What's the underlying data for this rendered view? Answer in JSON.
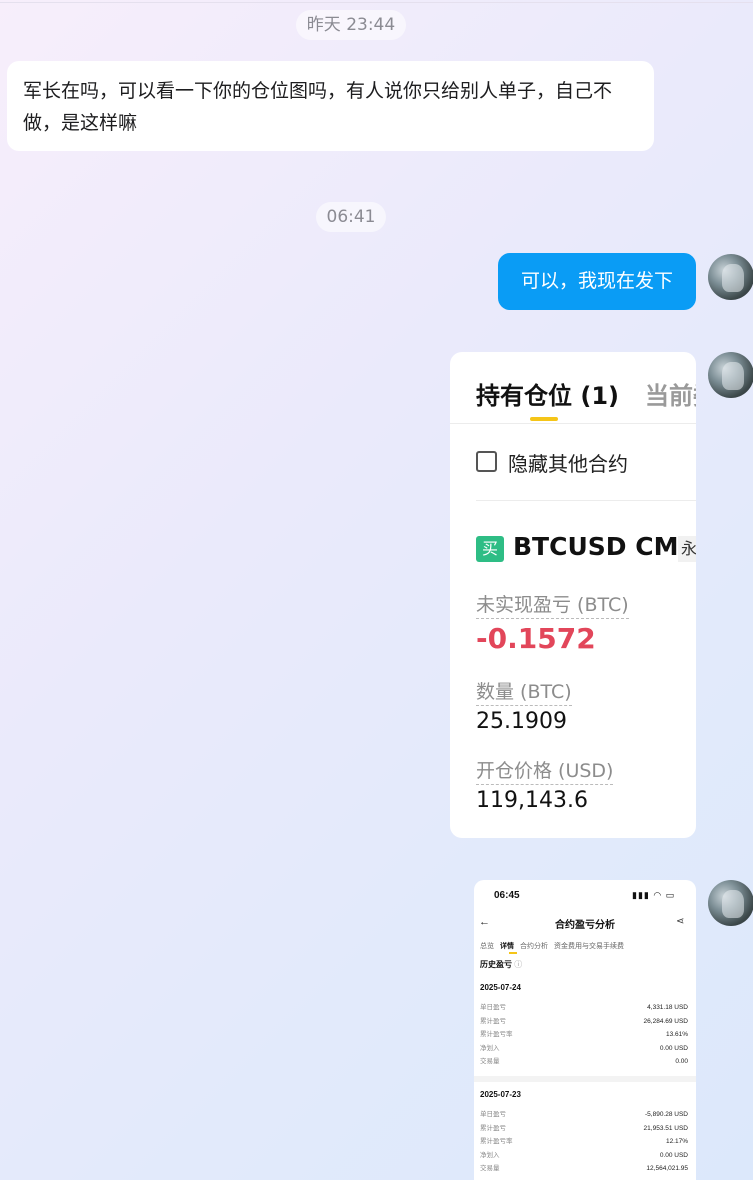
{
  "chat": {
    "timestamp_1": "昨天 23:44",
    "message_1": "军长在吗，可以看一下你的仓位图吗，有人说你只给别人单子，自己不做，是这样嘛",
    "timestamp_2": "06:41",
    "message_2": "可以，我现在发下"
  },
  "position_card": {
    "tab_active": "持有仓位 (1)",
    "tab_other": "当前委",
    "hide_label": "隐藏其他合约",
    "buy_badge": "买",
    "symbol": "BTCUSD CM",
    "tag": "永",
    "unrealized_label": "未实现盈亏 (BTC)",
    "unrealized_value": "-0.1572",
    "quantity_label": "数量 (BTC)",
    "quantity_value": "25.1909",
    "entry_label": "开仓价格 (USD)",
    "entry_value": "119,143.6",
    "pnl_color": "#e2465a",
    "buy_color": "#2ebd85"
  },
  "phone_screenshot": {
    "time": "06:45",
    "status_icons": "▮▮▮ ◠ ▭",
    "title": "合约盈亏分析",
    "tabs": [
      "总览",
      "详情",
      "合约分析",
      "资金费用与交易手续费"
    ],
    "history_title": "历史盈亏",
    "days": [
      {
        "date": "2025-07-24",
        "rows": [
          {
            "k": "单日盈亏",
            "v": "4,331.18 USD"
          },
          {
            "k": "累计盈亏",
            "v": "26,284.69 USD"
          },
          {
            "k": "累计盈亏率",
            "v": "13.61%"
          },
          {
            "k": "净划入",
            "v": "0.00 USD"
          },
          {
            "k": "交易量",
            "v": "0.00"
          }
        ]
      },
      {
        "date": "2025-07-23",
        "rows": [
          {
            "k": "单日盈亏",
            "v": "-5,890.28 USD"
          },
          {
            "k": "累计盈亏",
            "v": "21,953.51 USD"
          },
          {
            "k": "累计盈亏率",
            "v": "12.17%"
          },
          {
            "k": "净划入",
            "v": "0.00 USD"
          },
          {
            "k": "交易量",
            "v": "12,564,021.95"
          }
        ]
      }
    ]
  }
}
